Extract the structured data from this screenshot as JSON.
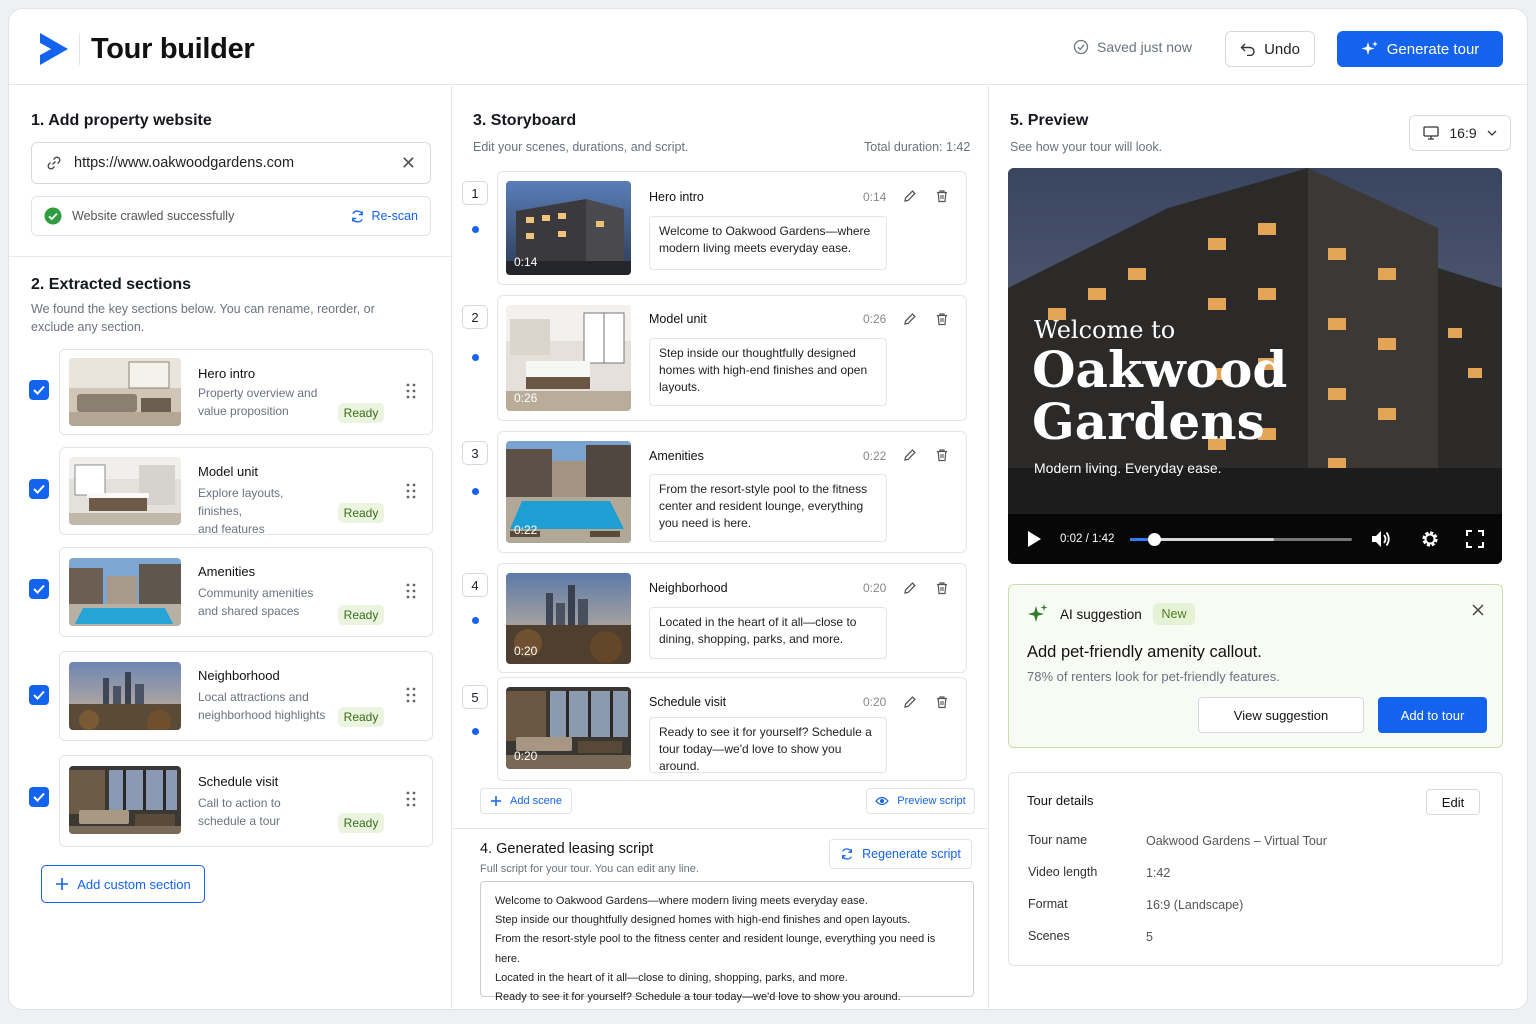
{
  "header": {
    "title": "Tour builder",
    "saved": "Saved just now",
    "undo": "Undo",
    "generate": "Generate tour"
  },
  "website": {
    "heading": "1. Add property website",
    "url": "https://www.oakwoodgardens.com",
    "status": "Website crawled successfully",
    "rescan": "Re-scan"
  },
  "sections": {
    "heading": "2. Extracted sections",
    "subtitle_l1": "We found the key sections below. You can rename, reorder, or",
    "subtitle_l2": "exclude any section.",
    "items": [
      {
        "name": "Hero intro",
        "desc1": "Property overview and",
        "desc2": "value proposition",
        "status": "Ready"
      },
      {
        "name": "Model unit",
        "desc1": "Explore layouts, finishes,",
        "desc2": "and features",
        "status": "Ready"
      },
      {
        "name": "Amenities",
        "desc1": "Community amenities",
        "desc2": "and shared spaces",
        "status": "Ready"
      },
      {
        "name": "Neighborhood",
        "desc1": "Local attractions and",
        "desc2": "neighborhood highlights",
        "status": "Ready"
      },
      {
        "name": "Schedule visit",
        "desc1": "Call to action to",
        "desc2": "schedule a tour",
        "status": "Ready"
      }
    ],
    "add_custom": "Add custom section"
  },
  "storyboard": {
    "heading": "3. Storyboard",
    "subtitle": "Edit your scenes, durations, and script.",
    "total": "Total duration: 1:42",
    "scenes": [
      {
        "num": "1",
        "title": "Hero intro",
        "time": "0:14",
        "script": "Welcome to Oakwood Gardens—where modern living meets everyday ease."
      },
      {
        "num": "2",
        "title": "Model unit",
        "time": "0:26",
        "script": "Step inside our thoughtfully designed homes with high-end finishes and open layouts."
      },
      {
        "num": "3",
        "title": "Amenities",
        "time": "0:22",
        "script": "From the resort-style pool to the fitness center and resident lounge, everything you need is here."
      },
      {
        "num": "4",
        "title": "Neighborhood",
        "time": "0:20",
        "script": "Located in the heart of it all—close to dining, shopping, parks, and more."
      },
      {
        "num": "5",
        "title": "Schedule visit",
        "time": "0:20",
        "script": "Ready to see it for yourself? Schedule a tour today—we'd love to show you around."
      }
    ],
    "add_scene": "Add scene",
    "preview_script": "Preview script"
  },
  "script": {
    "heading": "4. Generated leasing script",
    "subtitle": "Full script for your tour. You can edit any line.",
    "regenerate": "Regenerate script",
    "lines": [
      "Welcome to Oakwood Gardens—where modern living meets everyday ease.",
      "Step inside our thoughtfully designed homes with high-end finishes and open layouts.",
      "From the resort-style pool to the fitness center and resident lounge, everything you need is here.",
      "Located in the heart of it all—close to dining, shopping, parks, and more.",
      "Ready to see it for yourself? Schedule a tour today—we'd love to show you around."
    ]
  },
  "preview": {
    "heading": "5. Preview",
    "subtitle": "See how your tour will look.",
    "aspect": "16:9",
    "video": {
      "welcome": "Welcome to",
      "name1": "Oakwood",
      "name2": "Gardens",
      "tagline": "Modern living. Everyday ease.",
      "current": "0:02",
      "separator": "/",
      "total": "1:42",
      "buffered_fraction": 0.65,
      "played_fraction": 0.11
    }
  },
  "ai": {
    "label": "AI suggestion",
    "badge": "New",
    "title": "Add pet-friendly amenity callout.",
    "detail": "78% of renters look for pet-friendly features.",
    "view": "View suggestion",
    "add": "Add to tour"
  },
  "details": {
    "heading": "Tour details",
    "edit": "Edit",
    "rows": [
      {
        "key": "Tour name",
        "value": "Oakwood Gardens – Virtual Tour"
      },
      {
        "key": "Video length",
        "value": "1:42"
      },
      {
        "key": "Format",
        "value": "16:9 (Landscape)"
      },
      {
        "key": "Scenes",
        "value": "5"
      }
    ]
  },
  "colors": {
    "accent": "#1463ef",
    "ready_bg": "#eaf4df",
    "ai_border": "#c9dfa8"
  }
}
